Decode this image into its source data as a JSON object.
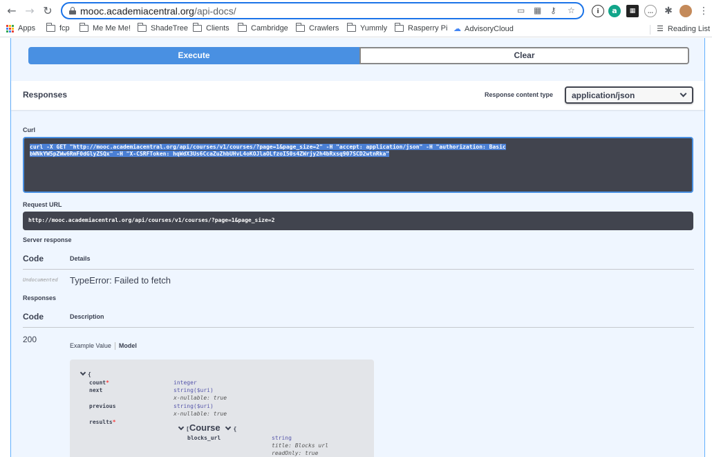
{
  "browser": {
    "url_host": "mooc.academiacentral.org",
    "url_path": "/api-docs/",
    "bookmarks": [
      "Apps",
      "fcp",
      "Me Me Me!",
      "ShadeTree",
      "Clients",
      "Cambridge",
      "Crawlers",
      "Yummly",
      "Rasperry Pi",
      "AdvisoryCloud"
    ],
    "reading_list": "Reading List"
  },
  "actions": {
    "execute": "Execute",
    "clear": "Clear"
  },
  "responses_header": {
    "title": "Responses",
    "content_type_label": "Response content type",
    "content_type_value": "application/json"
  },
  "curl": {
    "label": "Curl",
    "line1": "curl -X GET \"http://mooc.academiacentral.org/api/courses/v1/courses/?page=1&page_size=2\" -H \"accept: application/json\" -H \"authorization: Basic",
    "line2": "bWNkYW5pZWw6RmF0dGlyZSQx\" -H \"X-CSRFToken: hqWdX3Us6CcaZuZhbUHvL4oKOJlaOLfzoI50s4ZWrjy2h4bRxsq907SCD2wtnRka\""
  },
  "request_url": {
    "label": "Request URL",
    "value": "http://mooc.academiacentral.org/api/courses/v1/courses/?page=1&page_size=2"
  },
  "server_response": {
    "label": "Server response",
    "col_code": "Code",
    "col_details": "Details",
    "code": "Undocumented",
    "details": "TypeError: Failed to fetch"
  },
  "responses_table": {
    "label": "Responses",
    "col_code": "Code",
    "col_description": "Description",
    "code": "200",
    "tab_example": "Example Value",
    "tab_model": "Model"
  },
  "model": {
    "open_brace": "{",
    "count_key": "count",
    "count_type": "integer",
    "next_key": "next",
    "next_type": "string($uri)",
    "next_meta": "x-nullable: true",
    "previous_key": "previous",
    "previous_type": "string($uri)",
    "previous_meta": "x-nullable: true",
    "results_key": "results",
    "results_open": "[",
    "course_name": "Course",
    "course_brace": "{",
    "blocks_url_key": "blocks_url",
    "blocks_url_type": "string",
    "blocks_url_title": "title: Blocks url",
    "blocks_url_readonly": "readOnly: true",
    "required_marker": "*"
  }
}
